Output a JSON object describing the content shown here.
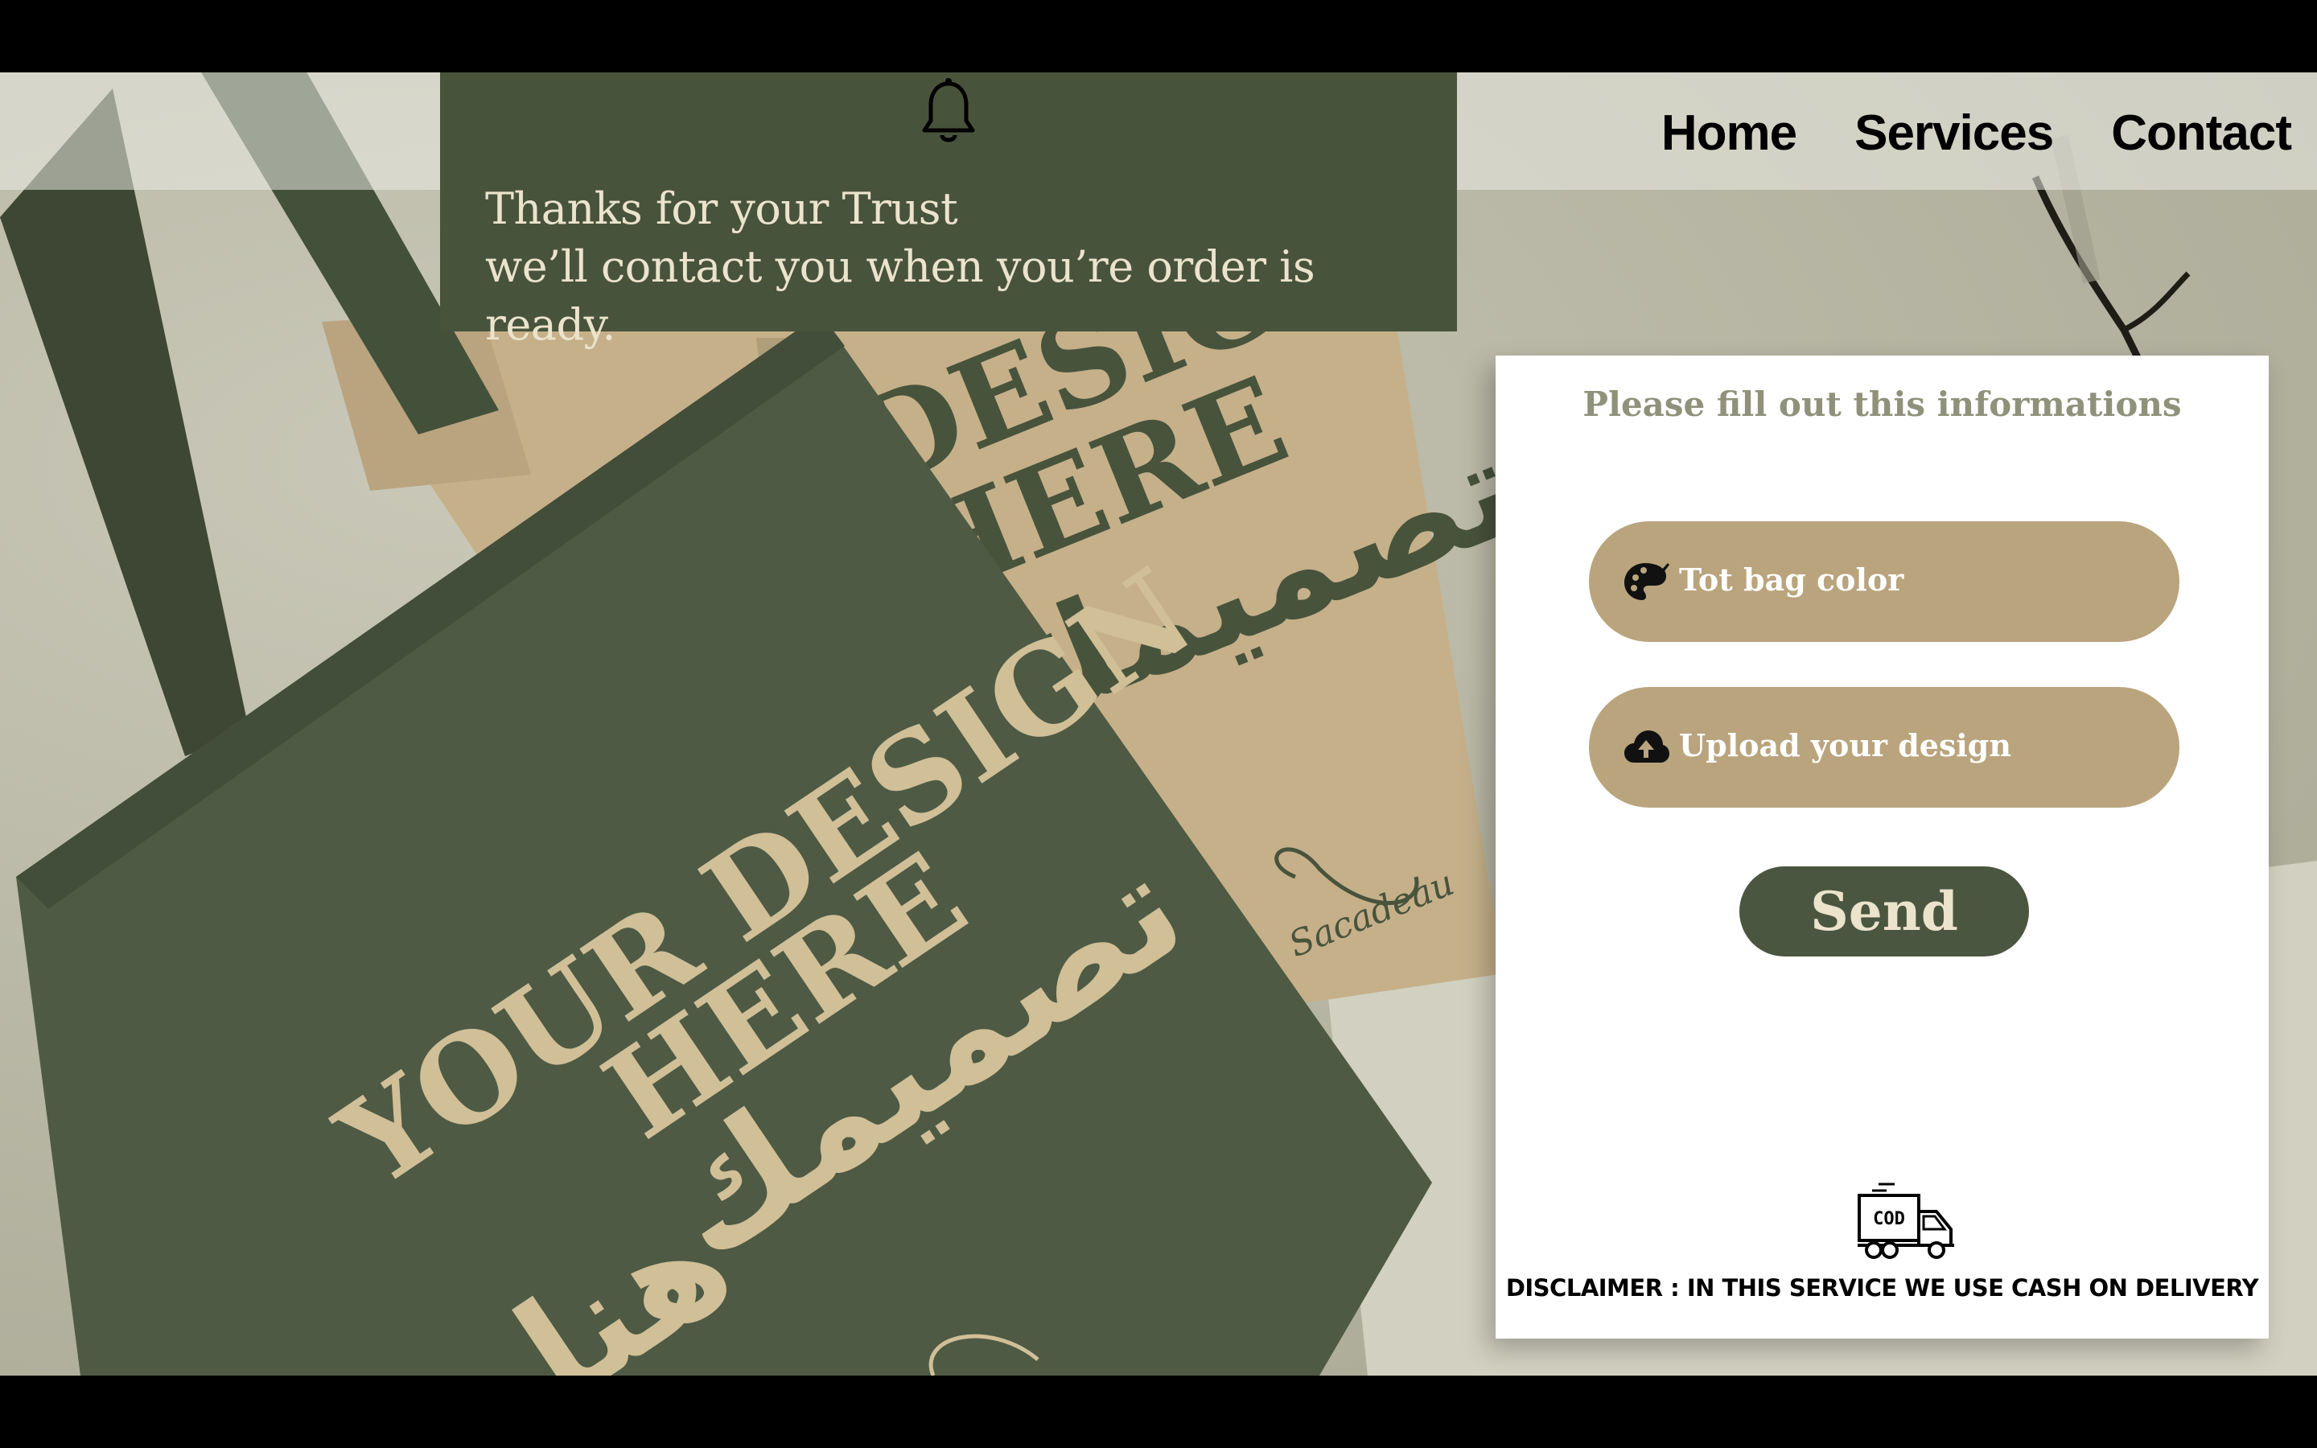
{
  "nav": {
    "items": [
      "Home",
      "Services",
      "Contact"
    ]
  },
  "notification": {
    "icon": "bell-icon",
    "line1": "Thanks for your Trust",
    "line2": "we’ll contact you when you’re order is ready."
  },
  "background": {
    "front_bag": {
      "line1": "YOUR DESIGN",
      "line2": "HERE",
      "arabic1": "تصميمك",
      "arabic2": "هنا"
    },
    "back_bag": {
      "line1": "DESIGN",
      "line2": "HERE",
      "arabic1": "تصميمك",
      "logo": "Sacadeau"
    }
  },
  "form": {
    "title": "Please fill out this informations",
    "color_field": {
      "label": "Tot bag color",
      "icon": "palette-icon"
    },
    "upload_field": {
      "label": "Upload your design",
      "icon": "cloud-upload-icon"
    },
    "send_label": "Send",
    "delivery_icon": "cod-truck-icon",
    "delivery_icon_text": "COD",
    "disclaimer": "DISCLAIMER : IN THIS SERVICE WE USE CASH ON DELIVERY"
  },
  "colors": {
    "primary_green": "#4a563f",
    "tan": "#b9a47d",
    "cream": "#ece3cc"
  }
}
